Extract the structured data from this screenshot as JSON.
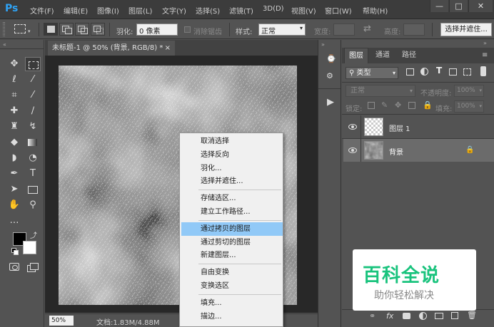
{
  "app": {
    "logo": "Ps"
  },
  "menubar": {
    "items": [
      "文件(F)",
      "编辑(E)",
      "图像(I)",
      "图层(L)",
      "文字(Y)",
      "选择(S)",
      "滤镜(T)",
      "3D(D)",
      "视图(V)",
      "窗口(W)",
      "帮助(H)"
    ],
    "window_controls": [
      "—",
      "□",
      "✕"
    ]
  },
  "options": {
    "feather_label": "羽化:",
    "feather_value": "0 像素",
    "antialias_label": "消除锯齿",
    "style_label": "样式:",
    "style_value": "正常",
    "width_label": "宽度:",
    "height_label": "高度:",
    "select_mask_button": "选择并遮住..."
  },
  "document": {
    "tab_title": "未标题-1 @ 50% (背景, RGB/8) *",
    "tab_close": "×",
    "zoom": "50%",
    "doc_info": "文档:1.83M/4.88M"
  },
  "layers_panel": {
    "tabs": [
      "图层",
      "通道",
      "路径"
    ],
    "filter_kind": "类型",
    "blend_mode": "正常",
    "opacity_label": "不透明度:",
    "opacity_value": "100%",
    "lock_label": "锁定:",
    "fill_label": "填充:",
    "fill_value": "100%",
    "layers": [
      {
        "name": "图层 1",
        "selected": false,
        "locked": false
      },
      {
        "name": "背景",
        "selected": true,
        "locked": true
      }
    ]
  },
  "context_menu": {
    "items": [
      {
        "label": "取消选择",
        "highlighted": false
      },
      {
        "label": "选择反向",
        "highlighted": false
      },
      {
        "label": "羽化...",
        "highlighted": false
      },
      {
        "label": "选择并遮住...",
        "highlighted": false
      },
      {
        "label": "存储选区...",
        "highlighted": false
      },
      {
        "label": "建立工作路径...",
        "highlighted": false
      },
      {
        "label": "通过拷贝的图层",
        "highlighted": true
      },
      {
        "label": "通过剪切的图层",
        "highlighted": false
      },
      {
        "label": "新建图层...",
        "highlighted": false
      },
      {
        "label": "自由变换",
        "highlighted": false
      },
      {
        "label": "变换选区",
        "highlighted": false
      },
      {
        "label": "填充...",
        "highlighted": false
      },
      {
        "label": "描边...",
        "highlighted": false
      }
    ]
  },
  "watermark": {
    "title": "百科全说",
    "subtitle": "助你轻松解决"
  },
  "colors": {
    "highlight": "#91c9f7",
    "accent": "#2fa3f5",
    "watermark_green": "#19c37d"
  }
}
